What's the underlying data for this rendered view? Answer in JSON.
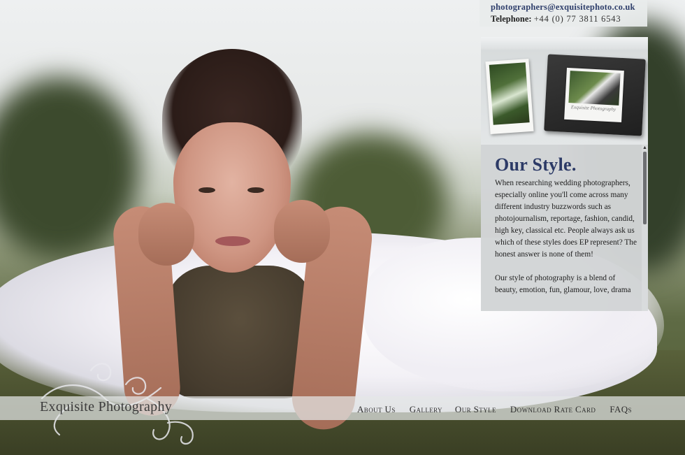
{
  "contact": {
    "email": "photographers@exquisitephoto.co.uk",
    "telephone_label": "Telephone:",
    "telephone_value": "+44 (0) 77 3811 6543"
  },
  "album": {
    "book_caption": "Exquisite Photography"
  },
  "style_section": {
    "heading": "Our Style.",
    "paragraphs": [
      "When researching wedding photographers, especially online you'll come across many different industry buzzwords such as photojournalism, reportage, fashion, candid, high key, classical etc. People always ask us which of these styles does EP represent? The honest answer is none of them!",
      "Our style of photography is a blend of beauty, emotion, fun, glamour, love, drama"
    ]
  },
  "navbar": {
    "brand": "Exquisite Photography",
    "items": [
      "About Us",
      "Gallery",
      "Our Style",
      "Download Rate Card",
      "FAQs"
    ]
  },
  "colors": {
    "heading": "#2c3a66",
    "email": "#2f3f6b",
    "panel": "#d8dbdc"
  }
}
